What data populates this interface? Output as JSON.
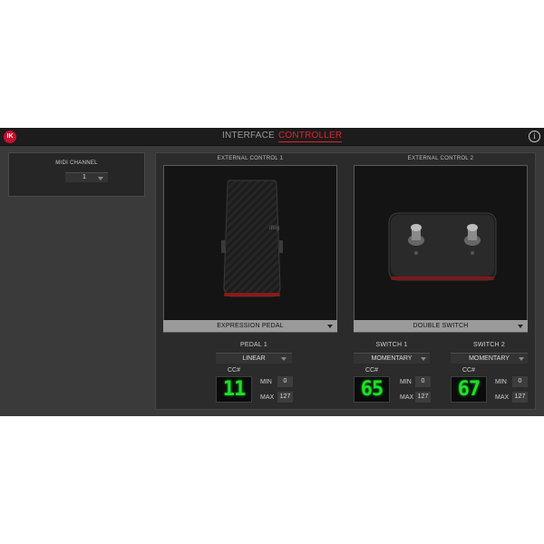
{
  "header": {
    "logo_text": "IK",
    "tabs": [
      {
        "label": "INTERFACE",
        "active": false
      },
      {
        "label": "CONTROLLER",
        "active": true
      }
    ],
    "info_label": "i",
    "accent_color": "#e0242b"
  },
  "midi": {
    "label": "MIDI CHANNEL",
    "value": "1"
  },
  "external": [
    {
      "title": "EXTERNAL CONTROL 1",
      "type": "EXPRESSION PEDAL",
      "pedal_brand": "iRig",
      "controls": [
        {
          "label": "PEDAL 1",
          "mode": "LINEAR",
          "cc_label": "CC#",
          "cc": "11",
          "min_label": "MIN",
          "min": "0",
          "max_label": "MAX",
          "max": "127"
        }
      ]
    },
    {
      "title": "EXTERNAL CONTROL 2",
      "type": "DOUBLE SWITCH",
      "controls": [
        {
          "label": "SWITCH 1",
          "mode": "MOMENTARY",
          "cc_label": "CC#",
          "cc": "65",
          "min_label": "MIN",
          "min": "0",
          "max_label": "MAX",
          "max": "127"
        },
        {
          "label": "SWITCH 2",
          "mode": "MOMENTARY",
          "cc_label": "CC#",
          "cc": "67",
          "min_label": "MIN",
          "min": "0",
          "max_label": "MAX",
          "max": "127"
        }
      ]
    }
  ],
  "icons": [
    "ik-logo-icon",
    "info-icon",
    "chevron-down-icon",
    "expression-pedal-icon",
    "double-switch-icon"
  ]
}
